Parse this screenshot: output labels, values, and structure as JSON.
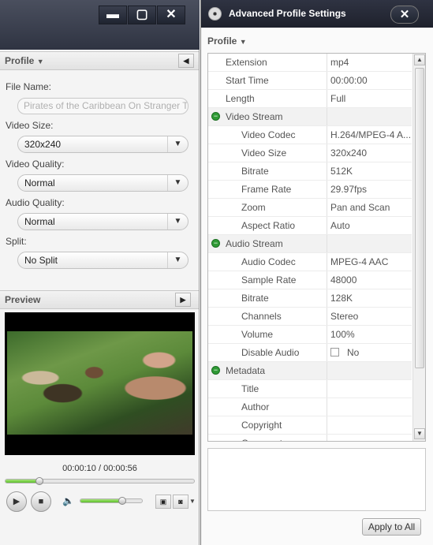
{
  "left_window": {
    "window_buttons": {
      "minimize": "▬",
      "maximize": "▢",
      "close": "✕"
    },
    "profile_header": "Profile",
    "file_name_label": "File Name:",
    "file_name_value": "Pirates of the Caribbean On Stranger Ti",
    "video_size_label": "Video Size:",
    "video_size_value": "320x240",
    "video_quality_label": "Video Quality:",
    "video_quality_value": "Normal",
    "audio_quality_label": "Audio Quality:",
    "audio_quality_value": "Normal",
    "split_label": "Split:",
    "split_value": "No Split",
    "preview_header": "Preview",
    "timecode": "00:00:10 / 00:00:56",
    "progress_fraction": 0.18,
    "volume_fraction": 0.68
  },
  "right_window": {
    "title": "Advanced Profile Settings",
    "profile_label": "Profile",
    "rows": [
      {
        "key": "Extension",
        "value": "mp4",
        "level": 1
      },
      {
        "key": "Start Time",
        "value": "00:00:00",
        "level": 1
      },
      {
        "key": "Length",
        "value": "Full",
        "level": 1
      },
      {
        "key": "Video Stream",
        "value": "",
        "level": 0,
        "group": true
      },
      {
        "key": "Video Codec",
        "value": "H.264/MPEG-4 A...",
        "level": 2
      },
      {
        "key": "Video Size",
        "value": "320x240",
        "level": 2
      },
      {
        "key": "Bitrate",
        "value": "512K",
        "level": 2
      },
      {
        "key": "Frame Rate",
        "value": "29.97fps",
        "level": 2
      },
      {
        "key": "Zoom",
        "value": "Pan and Scan",
        "level": 2
      },
      {
        "key": "Aspect Ratio",
        "value": "Auto",
        "level": 2
      },
      {
        "key": "Audio Stream",
        "value": "",
        "level": 0,
        "group": true
      },
      {
        "key": "Audio Codec",
        "value": "MPEG-4 AAC",
        "level": 2
      },
      {
        "key": "Sample Rate",
        "value": "48000",
        "level": 2
      },
      {
        "key": "Bitrate",
        "value": "128K",
        "level": 2
      },
      {
        "key": "Channels",
        "value": "Stereo",
        "level": 2
      },
      {
        "key": "Volume",
        "value": "100%",
        "level": 2
      },
      {
        "key": "Disable Audio",
        "value": "No",
        "level": 2,
        "checkbox": true
      },
      {
        "key": "Metadata",
        "value": "",
        "level": 0,
        "group": true
      },
      {
        "key": "Title",
        "value": "",
        "level": 2
      },
      {
        "key": "Author",
        "value": "",
        "level": 2
      },
      {
        "key": "Copyright",
        "value": "",
        "level": 2
      },
      {
        "key": "Comment",
        "value": "",
        "level": 2
      }
    ],
    "apply_button": "Apply to All"
  }
}
